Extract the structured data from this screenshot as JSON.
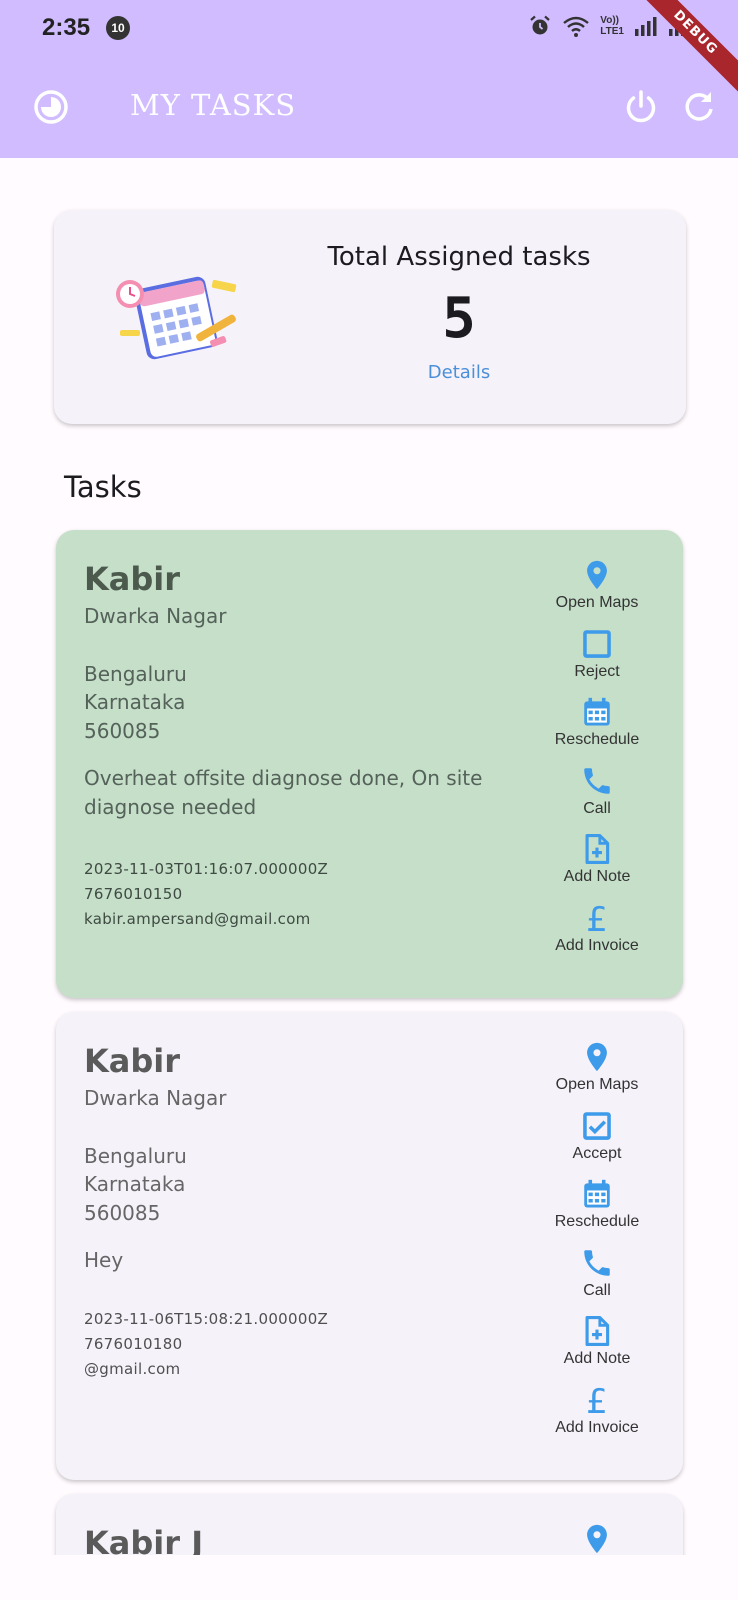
{
  "status_bar": {
    "time": "2:35",
    "notification_count": "10",
    "network_label_top": "Vo))",
    "network_label_bottom": "LTE1"
  },
  "debug_banner": "DEBUG",
  "app_bar": {
    "title": "MY TASKS",
    "leading_icon": "history-icon",
    "actions": [
      "power-icon",
      "refresh-icon"
    ],
    "color": "#d0bcff"
  },
  "summary": {
    "title": "Total Assigned tasks",
    "count": "5",
    "details_link": "Details"
  },
  "tasks_heading": "Tasks",
  "tasks": [
    {
      "status_color": "#c5dfc9",
      "name": "Kabir",
      "area": "Dwarka Nagar",
      "city": "Bengaluru",
      "state": "Karnataka",
      "pincode": "560085",
      "description": "Overheat offsite diagnose done, On site diagnose needed",
      "timestamp": "2023-11-03T01:16:07.000000Z",
      "phone": "7676010150",
      "email": "kabir.ampersand@gmail.com",
      "actions": [
        {
          "label": "Open Maps",
          "icon": "map-pin-icon"
        },
        {
          "label": "Reject",
          "icon": "checkbox-empty-icon"
        },
        {
          "label": "Reschedule",
          "icon": "calendar-icon"
        },
        {
          "label": "Call",
          "icon": "phone-icon"
        },
        {
          "label": "Add Note",
          "icon": "note-add-icon"
        },
        {
          "label": "Add Invoice",
          "icon": "pound-icon"
        }
      ]
    },
    {
      "status_color": "#f6f2fa",
      "name": "Kabir",
      "area": "Dwarka Nagar",
      "city": "Bengaluru",
      "state": "Karnataka",
      "pincode": "560085",
      "description": "Hey",
      "timestamp": "2023-11-06T15:08:21.000000Z",
      "phone": "7676010180",
      "email": "@gmail.com",
      "actions": [
        {
          "label": "Open Maps",
          "icon": "map-pin-icon"
        },
        {
          "label": "Accept",
          "icon": "checkbox-checked-icon"
        },
        {
          "label": "Reschedule",
          "icon": "calendar-icon"
        },
        {
          "label": "Call",
          "icon": "phone-icon"
        },
        {
          "label": "Add Note",
          "icon": "note-add-icon"
        },
        {
          "label": "Add Invoice",
          "icon": "pound-icon"
        }
      ]
    },
    {
      "name": "Kabir J",
      "actions": [
        {
          "icon": "map-pin-icon"
        }
      ]
    }
  ],
  "colors": {
    "accent_blue": "#3d9be9",
    "link_blue": "#4a8fd8"
  }
}
